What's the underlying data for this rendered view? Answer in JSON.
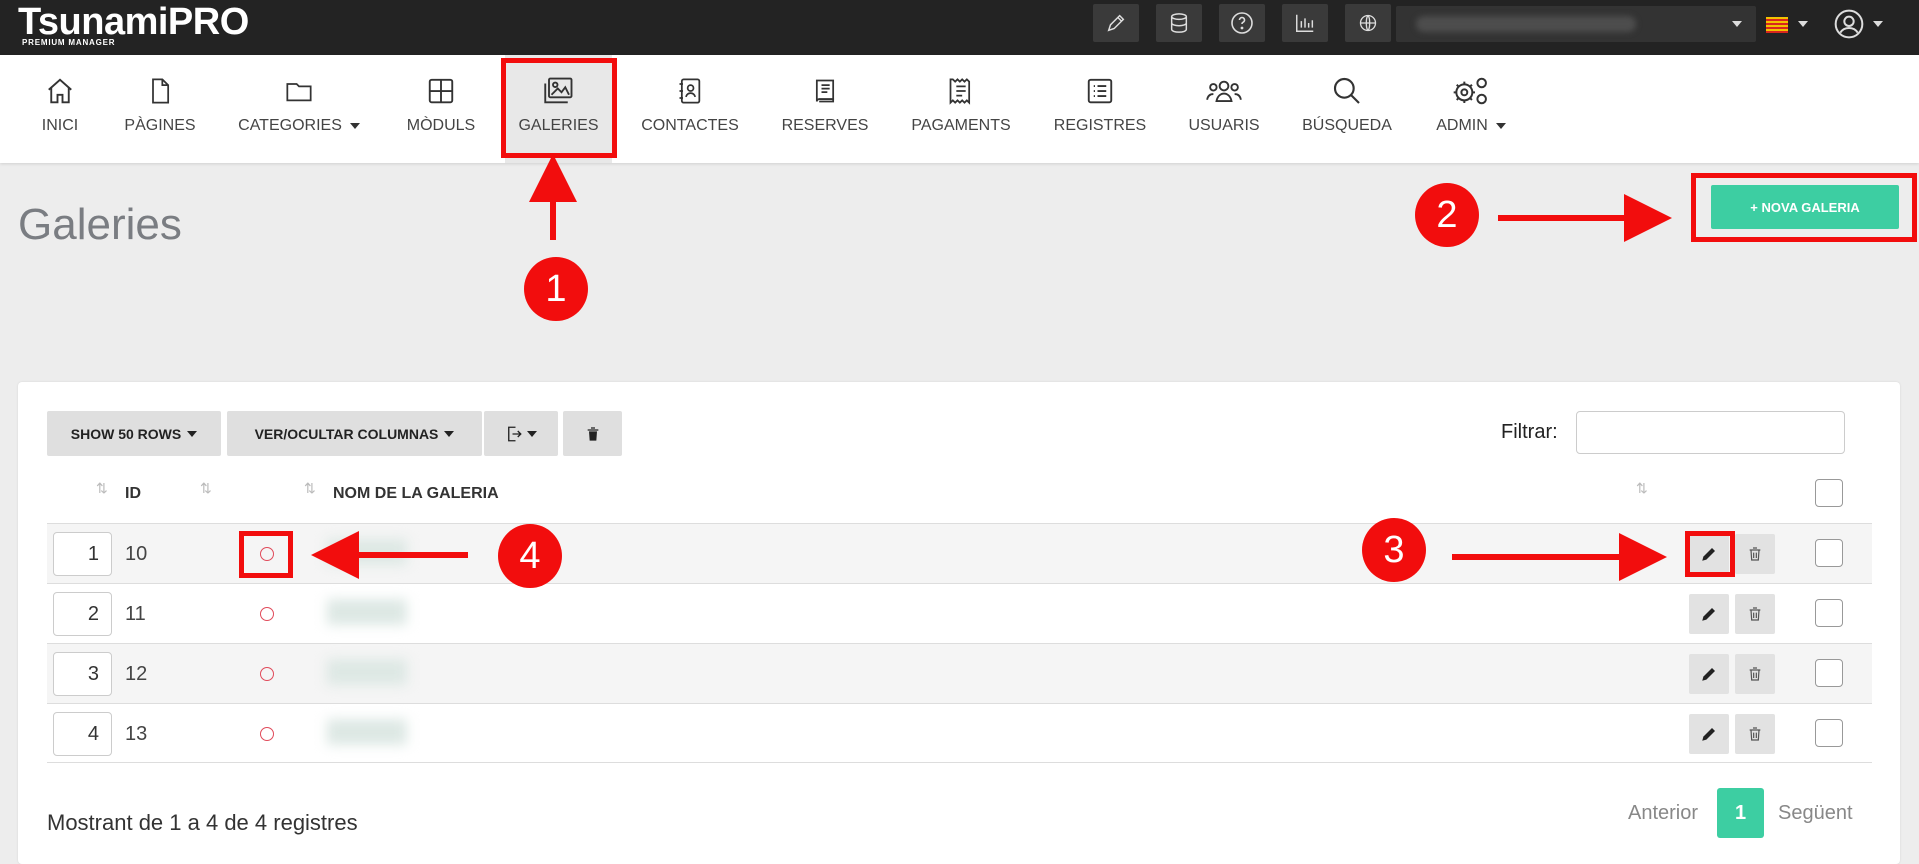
{
  "app": {
    "logo_main": "TsunamiPRO",
    "logo_sub": "PREMIUM MANAGER"
  },
  "topbar": {
    "buttons": [
      "pencil-icon",
      "database-icon",
      "help-icon",
      "stats-icon",
      "globe-icon"
    ]
  },
  "nav": {
    "items": [
      {
        "label": "INICI",
        "icon": "home-icon"
      },
      {
        "label": "PÀGINES",
        "icon": "page-icon"
      },
      {
        "label": "CATEGORIES",
        "icon": "folder-icon",
        "dropdown": true
      },
      {
        "label": "MÒDULS",
        "icon": "grid-icon"
      },
      {
        "label": "GALERIES",
        "icon": "image-gallery-icon",
        "active": true
      },
      {
        "label": "CONTACTES",
        "icon": "contacts-icon"
      },
      {
        "label": "RESERVES",
        "icon": "book-icon"
      },
      {
        "label": "PAGAMENTS",
        "icon": "receipt-icon"
      },
      {
        "label": "REGISTRES",
        "icon": "list-icon"
      },
      {
        "label": "USUARIS",
        "icon": "users-icon"
      },
      {
        "label": "BÚSQUEDA",
        "icon": "search-icon"
      },
      {
        "label": "ADMIN",
        "icon": "gears-icon",
        "dropdown": true
      }
    ]
  },
  "page": {
    "title": "Galeries",
    "new_button": "+ NOVA GALERIA"
  },
  "toolbar": {
    "show_rows": "SHOW 50 ROWS",
    "columns": "VER/OCULTAR COLUMNAS",
    "filter_label": "Filtrar:"
  },
  "table": {
    "headers": {
      "id": "ID",
      "name": "NOM DE LA GALERIA"
    },
    "rows": [
      {
        "order": "1",
        "id": "10"
      },
      {
        "order": "2",
        "id": "11"
      },
      {
        "order": "3",
        "id": "12"
      },
      {
        "order": "4",
        "id": "13"
      }
    ]
  },
  "footer": {
    "info": "Mostrant de 1 a 4 de 4 registres",
    "prev": "Anterior",
    "page": "1",
    "next": "Següent"
  },
  "annotations": [
    "1",
    "2",
    "3",
    "4"
  ],
  "colors": {
    "accent": "#3dcea2",
    "annotation": "#f20d0d",
    "topbar": "#232323"
  }
}
